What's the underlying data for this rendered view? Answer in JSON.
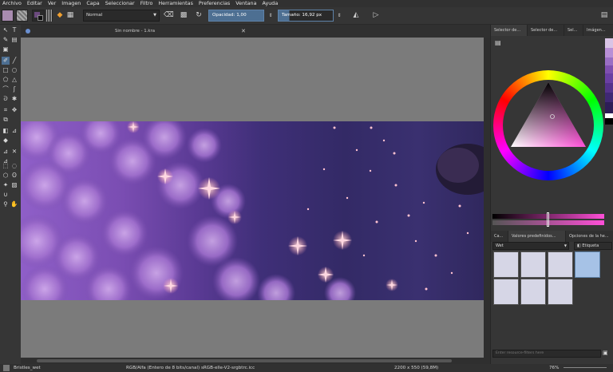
{
  "menu": [
    "Archivo",
    "Editar",
    "Ver",
    "Imagen",
    "Capa",
    "Seleccionar",
    "Filtro",
    "Herramientas",
    "Preferencias",
    "Ventana",
    "Ayuda"
  ],
  "toolbar": {
    "blend_mode": "Normal",
    "opacity_label": "Opacidad: 1,00",
    "size_label": "Tamaño: 16,92 px"
  },
  "document": {
    "tab_title": "Sin nombre - 1.kra"
  },
  "panel": {
    "top_tabs": [
      "Selector de...",
      "Selector de...",
      "Sel...",
      "Imágen..."
    ],
    "bottom_tabs": [
      "Ca...",
      "Valores predefinidos...",
      "Opciones de la he..."
    ],
    "preset_tag": "Wet",
    "tag_button": "Etiqueta",
    "filter_placeholder": "Enter resource-filters here"
  },
  "status": {
    "brush": "Bristles_wet",
    "color_model": "RGB/Alfa (Entero de 8 bits/canal)  sRGB-elle-V2-srgbtrc.icc",
    "dimensions": "2200 x 550 (59,8M)",
    "zoom": "76%"
  },
  "colors": {
    "foreground": "#a98cb0",
    "accent": "#4d6f92",
    "canvas_bg": "#7b7b7b",
    "palette": [
      "#d9c4e6",
      "#b88fd6",
      "#9a6ec4",
      "#7f4fb0",
      "#6a3fa3",
      "#55328c",
      "#3f2874",
      "#2d1d57",
      "#ffffff",
      "#000000"
    ]
  },
  "icons": [
    "layer-icon",
    "eraser-icon",
    "preserve-alpha-icon",
    "reload-icon",
    "mirror-h-icon",
    "mirror-v-icon",
    "menu-icon",
    "close-icon"
  ]
}
